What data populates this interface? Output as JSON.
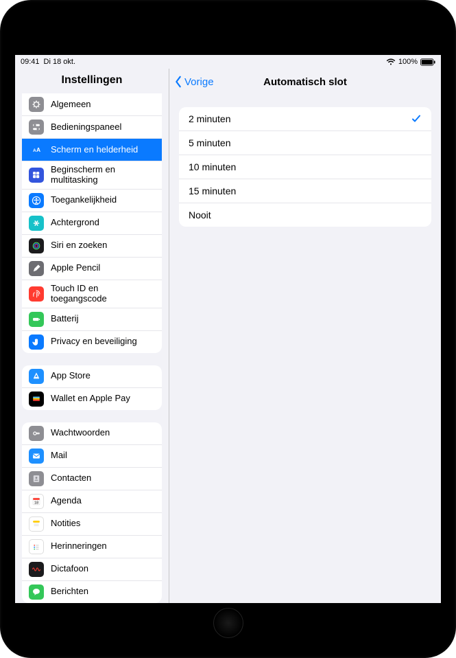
{
  "statusbar": {
    "time": "09:41",
    "date": "Di 18 okt.",
    "battery_pct": "100%"
  },
  "sidebar": {
    "title": "Instellingen",
    "group1": [
      {
        "label": "Algemeen",
        "icon": "gear",
        "bg": "#8e8e93"
      },
      {
        "label": "Bedieningspaneel",
        "icon": "switches",
        "bg": "#8e8e93"
      },
      {
        "label": "Scherm en helderheid",
        "icon": "aa",
        "bg": "#0a7aff",
        "selected": true
      },
      {
        "label": "Beginscherm en multitasking",
        "icon": "grid",
        "bg": "#3355dd"
      },
      {
        "label": "Toegankelijkheid",
        "icon": "access",
        "bg": "#0a7aff"
      },
      {
        "label": "Achtergrond",
        "icon": "flower",
        "bg": "#17c1c9"
      },
      {
        "label": "Siri en zoeken",
        "icon": "siri",
        "bg": "#1b1b1d"
      },
      {
        "label": "Apple Pencil",
        "icon": "pencil",
        "bg": "#6d6d72"
      },
      {
        "label": "Touch ID en toegangscode",
        "icon": "finger",
        "bg": "#ff3b30"
      },
      {
        "label": "Batterij",
        "icon": "battery",
        "bg": "#34c759"
      },
      {
        "label": "Privacy en beveiliging",
        "icon": "hand",
        "bg": "#0a7aff"
      }
    ],
    "group2": [
      {
        "label": "App Store",
        "icon": "appstore",
        "bg": "#1e90ff"
      },
      {
        "label": "Wallet en Apple Pay",
        "icon": "wallet",
        "bg": "#000000"
      }
    ],
    "group3": [
      {
        "label": "Wachtwoorden",
        "icon": "key",
        "bg": "#8e8e93"
      },
      {
        "label": "Mail",
        "icon": "mail",
        "bg": "#1e90ff"
      },
      {
        "label": "Contacten",
        "icon": "contacts",
        "bg": "#8e8e93"
      },
      {
        "label": "Agenda",
        "icon": "calendar",
        "bg": "#ffffff"
      },
      {
        "label": "Notities",
        "icon": "notes",
        "bg": "#ffffff"
      },
      {
        "label": "Herinneringen",
        "icon": "reminders",
        "bg": "#ffffff"
      },
      {
        "label": "Dictafoon",
        "icon": "voice",
        "bg": "#1b1b1d"
      },
      {
        "label": "Berichten",
        "icon": "messages",
        "bg": "#34c759"
      }
    ]
  },
  "detail": {
    "back_label": "Vorige",
    "title": "Automatisch slot",
    "options": [
      {
        "label": "2 minuten",
        "selected": true
      },
      {
        "label": "5 minuten",
        "selected": false
      },
      {
        "label": "10 minuten",
        "selected": false
      },
      {
        "label": "15 minuten",
        "selected": false
      },
      {
        "label": "Nooit",
        "selected": false
      }
    ]
  }
}
